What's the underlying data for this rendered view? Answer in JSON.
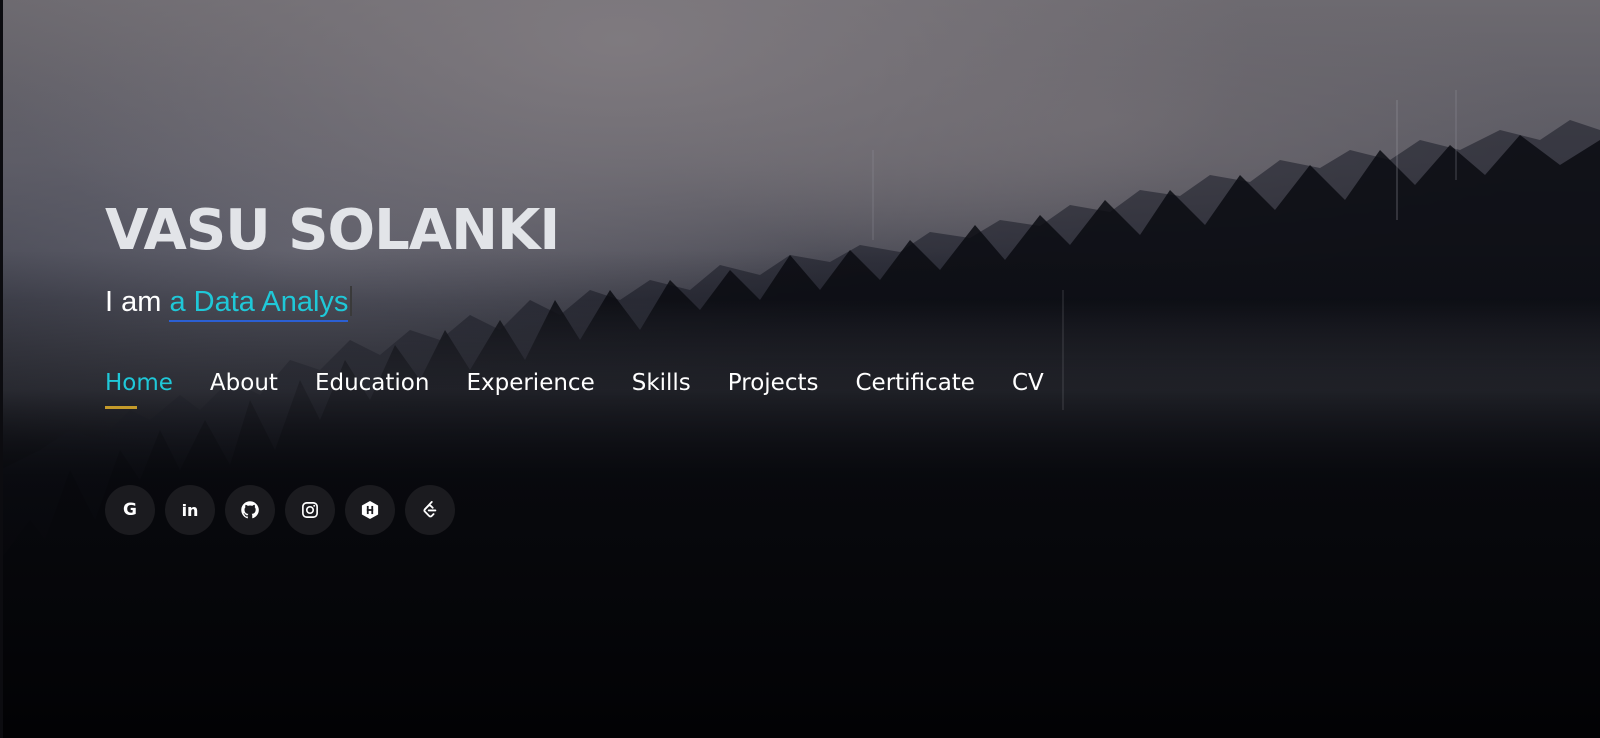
{
  "hero": {
    "name": "VASU SOLANKI",
    "tagline_prefix": "I am ",
    "tagline_typed": "a Data Analys",
    "accent_color": "#1fc8d8",
    "underline_color": "#c49a2a"
  },
  "nav": {
    "items": [
      {
        "label": "Home",
        "active": true
      },
      {
        "label": "About",
        "active": false
      },
      {
        "label": "Education",
        "active": false
      },
      {
        "label": "Experience",
        "active": false
      },
      {
        "label": "Skills",
        "active": false
      },
      {
        "label": "Projects",
        "active": false
      },
      {
        "label": "Certificate",
        "active": false
      },
      {
        "label": "CV",
        "active": false
      }
    ]
  },
  "socials": [
    {
      "icon": "google-icon",
      "glyph": "G"
    },
    {
      "icon": "linkedin-icon",
      "glyph": "in"
    },
    {
      "icon": "github-icon"
    },
    {
      "icon": "instagram-icon"
    },
    {
      "icon": "hackerrank-icon"
    },
    {
      "icon": "leetcode-icon"
    }
  ]
}
